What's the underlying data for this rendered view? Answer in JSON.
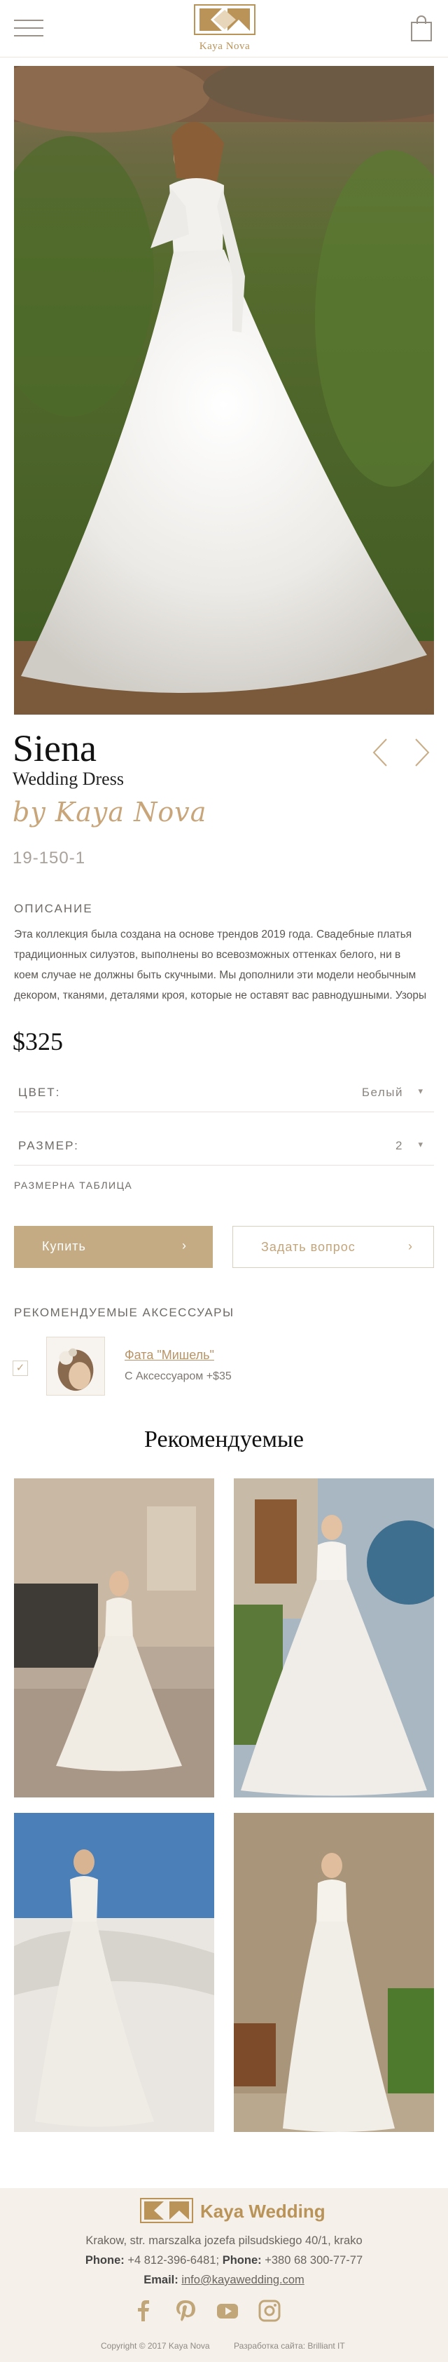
{
  "header": {
    "menu_icon": "hamburger-menu-icon",
    "logo_text": "Kaya Nova",
    "cart_icon": "shopping-bag-icon"
  },
  "product": {
    "name": "Siena",
    "subtitle": "Wedding Dress",
    "brand": "by Kaya Nova",
    "sku": "19-150-1",
    "prev_icon": "chevron-left-icon",
    "next_icon": "chevron-right-icon"
  },
  "description": {
    "label": "ОПИСАНИЕ",
    "lines": [
      "Эта коллекция была создана на основе трендов 2019 года. Свадебные платья",
      "традиционных силуэтов, выполнены во всевозможных оттенках белого, ни в",
      "коем случае не должны быть скучными. Мы дополнили эти модели необычным",
      "декором, тканями, деталями кроя, которые не оставят вас равнодушными. Узоры"
    ]
  },
  "price": "$325",
  "options": {
    "color_label": "ЦВЕТ:",
    "color_value": "Белый",
    "size_label": "РАЗМЕР:",
    "size_value": "2",
    "size_table": "РАЗМЕРНА ТАБЛИЦА"
  },
  "actions": {
    "buy": "Купить",
    "ask": "Задать вопрос"
  },
  "accessories": {
    "title": "РЕКОМЕНДУЕМЫЕ АКСЕССУАРЫ",
    "item_name": "Фата \"Мишель\"",
    "item_price": "С Аксессуаром +$35"
  },
  "recommended": {
    "title": "Рекомендуемые"
  },
  "footer": {
    "brand": "Kaya Wedding",
    "address": "Krakow, str. marszalka jozefa pilsudskiego 40/1, krako",
    "phone_label": "Phone:",
    "phone1": "+4 812-396-6481;",
    "phone2": "+380 68 300-77-77",
    "email_label": "Email:",
    "email": "info@kayawedding.com",
    "copyright": "Copyright © 2017 Kaya Nova",
    "developer": "Разработка сайта: Brilliant IT",
    "social_icons": [
      "facebook-icon",
      "pinterest-icon",
      "youtube-icon",
      "instagram-icon"
    ]
  },
  "colors": {
    "accent": "#c5ab83",
    "gold_text": "#b99358",
    "footer_bg": "#f5f1ea"
  }
}
